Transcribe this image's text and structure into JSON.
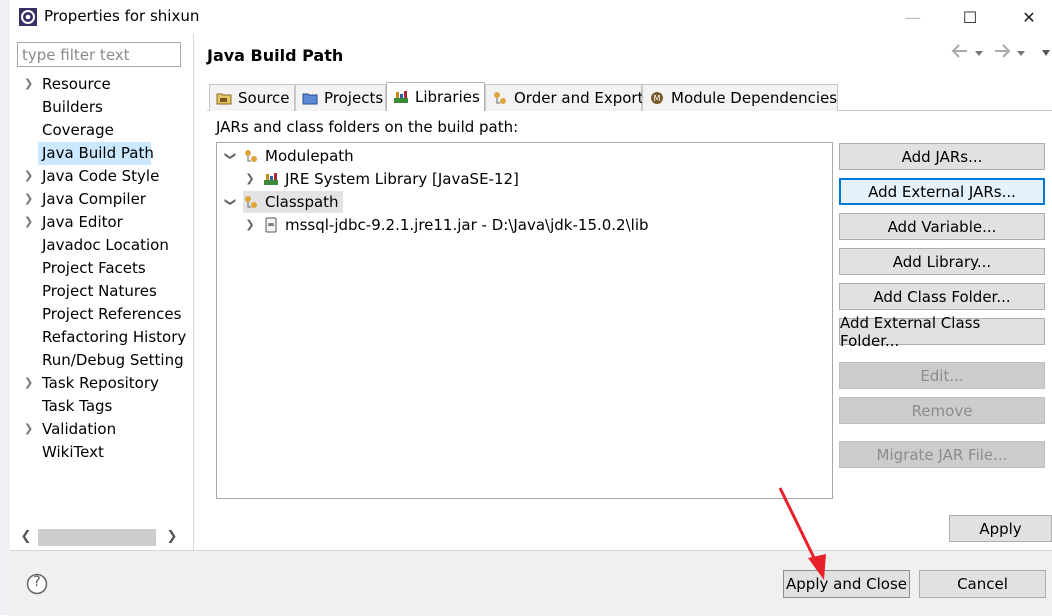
{
  "window": {
    "title": "Properties for shixun",
    "minimize_glyph": "—",
    "maximize_glyph": "☐",
    "close_glyph": "✕"
  },
  "filter": {
    "placeholder": "type filter text",
    "value": ""
  },
  "nav": {
    "items": [
      {
        "label": "Resource",
        "expandable": true
      },
      {
        "label": "Builders",
        "expandable": false
      },
      {
        "label": "Coverage",
        "expandable": false
      },
      {
        "label": "Java Build Path",
        "expandable": false,
        "selected": true
      },
      {
        "label": "Java Code Style",
        "expandable": true
      },
      {
        "label": "Java Compiler",
        "expandable": true
      },
      {
        "label": "Java Editor",
        "expandable": true
      },
      {
        "label": "Javadoc Location",
        "expandable": false
      },
      {
        "label": "Project Facets",
        "expandable": false
      },
      {
        "label": "Project Natures",
        "expandable": false
      },
      {
        "label": "Project References",
        "expandable": false
      },
      {
        "label": "Refactoring History",
        "expandable": false
      },
      {
        "label": "Run/Debug Setting",
        "expandable": false
      },
      {
        "label": "Task Repository",
        "expandable": true
      },
      {
        "label": "Task Tags",
        "expandable": false
      },
      {
        "label": "Validation",
        "expandable": true
      },
      {
        "label": "WikiText",
        "expandable": false
      }
    ]
  },
  "page": {
    "title": "Java Build Path",
    "tabs": [
      {
        "label": "Source",
        "icon": "source-folder-icon"
      },
      {
        "label": "Projects",
        "icon": "projects-icon"
      },
      {
        "label": "Libraries",
        "icon": "libraries-icon",
        "active": true
      },
      {
        "label": "Order and Export",
        "icon": "order-export-icon"
      },
      {
        "label": "Module Dependencies",
        "icon": "module-dependencies-icon"
      }
    ],
    "description": "JARs and class folders on the build path:",
    "tree": [
      {
        "label": "Modulepath",
        "expanded": true,
        "level": 0,
        "icon": "modulepath-icon"
      },
      {
        "label": "JRE System Library [JavaSE-12]",
        "expanded": false,
        "level": 1,
        "icon": "library-icon"
      },
      {
        "label": "Classpath",
        "expanded": true,
        "level": 0,
        "icon": "classpath-icon",
        "selected": true
      },
      {
        "label": "mssql-jdbc-9.2.1.jre11.jar - D:\\Java\\jdk-15.0.2\\lib",
        "expanded": false,
        "level": 1,
        "icon": "jar-icon"
      }
    ],
    "buttons": [
      {
        "label": "Add JARs...",
        "enabled": true
      },
      {
        "label": "Add External JARs...",
        "enabled": true,
        "focused": true
      },
      {
        "label": "Add Variable...",
        "enabled": true
      },
      {
        "label": "Add Library...",
        "enabled": true
      },
      {
        "label": "Add Class Folder...",
        "enabled": true
      },
      {
        "label": "Add External Class Folder...",
        "enabled": true
      },
      {
        "label": "Edit...",
        "enabled": false
      },
      {
        "label": "Remove",
        "enabled": false
      },
      {
        "label": "Migrate JAR File...",
        "enabled": false
      }
    ],
    "apply_label": "Apply"
  },
  "footer": {
    "help_glyph": "?",
    "apply_close_label": "Apply and Close",
    "cancel_label": "Cancel"
  },
  "colors": {
    "selection": "#cce8ff",
    "focus_border": "#0078d7",
    "annotation_arrow": "#e8202a"
  }
}
